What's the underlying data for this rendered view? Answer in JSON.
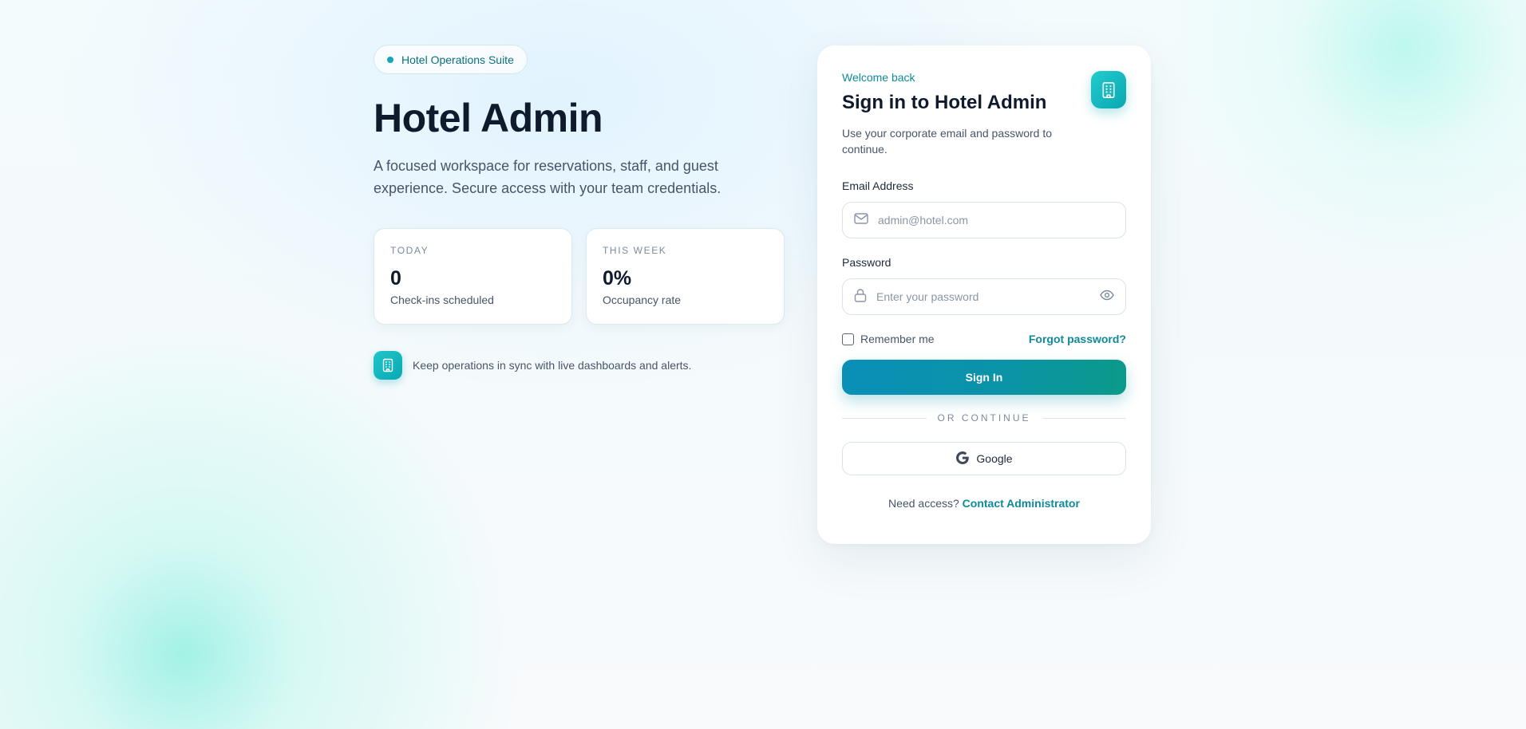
{
  "badge": {
    "label": "Hotel Operations Suite"
  },
  "hero": {
    "title": "Hotel Admin",
    "subtitle": "A focused workspace for reservations, staff, and guest experience. Secure access with your team credentials."
  },
  "stats": [
    {
      "label": "TODAY",
      "value": "0",
      "description": "Check-ins scheduled"
    },
    {
      "label": "THIS WEEK",
      "value": "0%",
      "description": "Occupancy rate"
    }
  ],
  "note": {
    "text": "Keep operations in sync with live dashboards and alerts."
  },
  "login": {
    "eyebrow": "Welcome back",
    "title": "Sign in to Hotel Admin",
    "subtitle": "Use your corporate email and password to continue.",
    "email": {
      "label": "Email Address",
      "placeholder": "admin@hotel.com",
      "value": ""
    },
    "password": {
      "label": "Password",
      "placeholder": "Enter your password",
      "value": ""
    },
    "remember_label": "Remember me",
    "forgot_label": "Forgot password?",
    "submit_label": "Sign In",
    "divider_label": "OR CONTINUE",
    "google_label": "Google",
    "access_prompt": "Need access?",
    "access_link": "Contact Administrator"
  },
  "colors": {
    "accent": "#0e8a99",
    "teal": "#12a6b8",
    "gradient_start": "#0a8fb7",
    "gradient_end": "#0b9a8a"
  },
  "icons": {
    "badge_dot": "status-dot",
    "hotel": "building-icon",
    "email": "mail-icon",
    "password": "lock-icon",
    "toggle": "eye-icon",
    "google": "google-icon"
  }
}
